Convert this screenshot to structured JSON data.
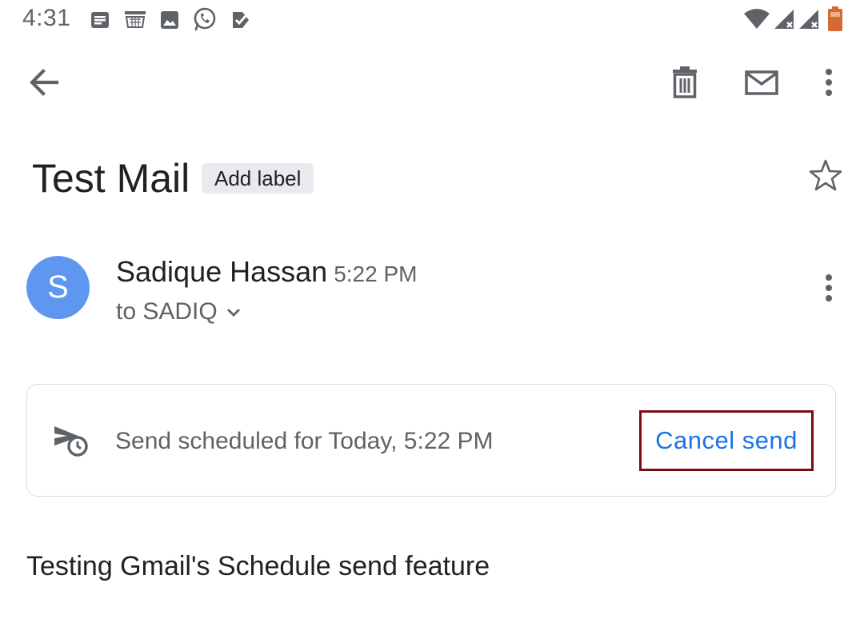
{
  "status_bar": {
    "time": "4:31",
    "notification_icons": [
      "message-icon",
      "amazon-icon",
      "gallery-icon",
      "whatsapp-icon",
      "tasks-icon"
    ],
    "system_icons": [
      "wifi-icon",
      "signal-icon",
      "signal-icon",
      "battery-icon"
    ]
  },
  "toolbar": {
    "back": "arrow-back-icon",
    "actions": [
      "delete-icon",
      "mark-unread-icon",
      "more-vert-icon"
    ]
  },
  "email": {
    "subject": "Test Mail",
    "label_chip": "Add label",
    "sender_initial": "S",
    "sender_name": "Sadique Hassan",
    "time": "5:22 PM",
    "recipient": "to SADIQ",
    "scheduled_text": "Send scheduled for Today, 5:22 PM",
    "cancel_label": "Cancel send",
    "body": "Testing Gmail's Schedule send feature"
  },
  "colors": {
    "avatar": "#5f97f0",
    "link": "#1a73e8",
    "highlight_border": "#7a0c13",
    "battery": "#d56a34"
  }
}
